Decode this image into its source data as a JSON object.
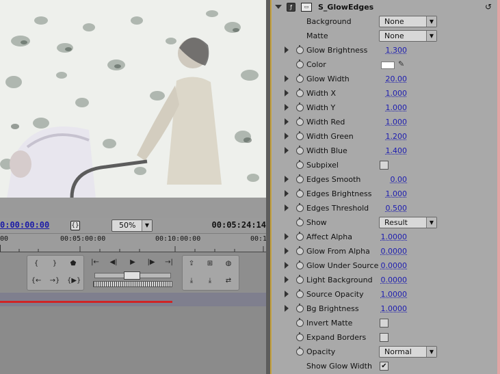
{
  "monitor": {
    "timecode_current": "0:00:00:00",
    "safe_margin_glyph": "{}",
    "zoom": "50%",
    "zoom_arrow": "▼",
    "timecode_duration": "00:05:24:14",
    "ruler": [
      "00",
      "00:05:00:00",
      "00:10:00:00",
      "00:1"
    ],
    "controls": {
      "mark_in": "{",
      "mark_out": "}",
      "set_marker": "⬟",
      "goto_in": "{←",
      "goto_out": "→}",
      "play_in_out": "{▶}",
      "step_back": "|←",
      "prev_frame": "◀|",
      "play": "▶",
      "next_frame": "|▶",
      "step_forward": "→|",
      "lift": "⇪",
      "extract": "⊞",
      "output": "◍",
      "insert": "⤓",
      "overlay": "⤓",
      "export_frame": "⇄"
    },
    "progress_fraction": 0.345
  },
  "effect": {
    "name": "S_GlowEdges",
    "fx_glyph": "ƒ",
    "reset_glyph": "↺",
    "params": [
      {
        "label": "Background",
        "kind": "dropdown",
        "value": "None",
        "tri": false,
        "sw": false
      },
      {
        "label": "Matte",
        "kind": "dropdown",
        "value": "None",
        "tri": false,
        "sw": false
      },
      {
        "label": "Glow Brightness",
        "kind": "number",
        "value": "1.300",
        "tri": true,
        "sw": true
      },
      {
        "label": "Color",
        "kind": "color",
        "value": "#ffffff",
        "tri": false,
        "sw": true
      },
      {
        "label": "Glow Width",
        "kind": "number",
        "value": "20.00",
        "tri": true,
        "sw": true
      },
      {
        "label": "Width X",
        "kind": "number",
        "value": "1.000",
        "tri": true,
        "sw": true
      },
      {
        "label": "Width Y",
        "kind": "number",
        "value": "1.000",
        "tri": true,
        "sw": true
      },
      {
        "label": "Width Red",
        "kind": "number",
        "value": "1.000",
        "tri": true,
        "sw": true
      },
      {
        "label": "Width Green",
        "kind": "number",
        "value": "1.200",
        "tri": true,
        "sw": true
      },
      {
        "label": "Width Blue",
        "kind": "number",
        "value": "1.400",
        "tri": true,
        "sw": true
      },
      {
        "label": "Subpixel",
        "kind": "checkbox",
        "value": "",
        "tri": false,
        "sw": true
      },
      {
        "label": "Edges Smooth",
        "kind": "number",
        "value": "0.00",
        "tri": true,
        "sw": true
      },
      {
        "label": "Edges Brightness",
        "kind": "number",
        "value": "1.000",
        "tri": true,
        "sw": true
      },
      {
        "label": "Edges Threshold",
        "kind": "number",
        "value": "0.500",
        "tri": true,
        "sw": true
      },
      {
        "label": "Show",
        "kind": "dropdown",
        "value": "Result",
        "tri": false,
        "sw": true
      },
      {
        "label": "Affect Alpha",
        "kind": "number",
        "value": "1.0000",
        "tri": true,
        "sw": true
      },
      {
        "label": "Glow From Alpha",
        "kind": "number",
        "value": "0.0000",
        "tri": true,
        "sw": true
      },
      {
        "label": "Glow Under Source",
        "kind": "number",
        "value": "0.0000",
        "tri": true,
        "sw": true
      },
      {
        "label": "Light Background",
        "kind": "number",
        "value": "0.0000",
        "tri": true,
        "sw": true
      },
      {
        "label": "Source Opacity",
        "kind": "number",
        "value": "1.0000",
        "tri": true,
        "sw": true
      },
      {
        "label": "Bg Brightness",
        "kind": "number",
        "value": "1.0000",
        "tri": true,
        "sw": true
      },
      {
        "label": "Invert Matte",
        "kind": "checkbox",
        "value": "",
        "tri": false,
        "sw": true
      },
      {
        "label": "Expand Borders",
        "kind": "checkbox",
        "value": "",
        "tri": false,
        "sw": true
      },
      {
        "label": "Opacity",
        "kind": "dropdown",
        "value": "Normal",
        "tri": false,
        "sw": true
      },
      {
        "label": "Show Glow Width",
        "kind": "checkbox",
        "value": "✔",
        "tri": false,
        "sw": false
      }
    ],
    "dropdown_arrow": "▼",
    "eyedropper_glyph": "✎"
  },
  "colors": {
    "timecode_blue": "#1a1aa8",
    "panel_accent": "#c7a23a",
    "timeline_red": "#d02424"
  }
}
